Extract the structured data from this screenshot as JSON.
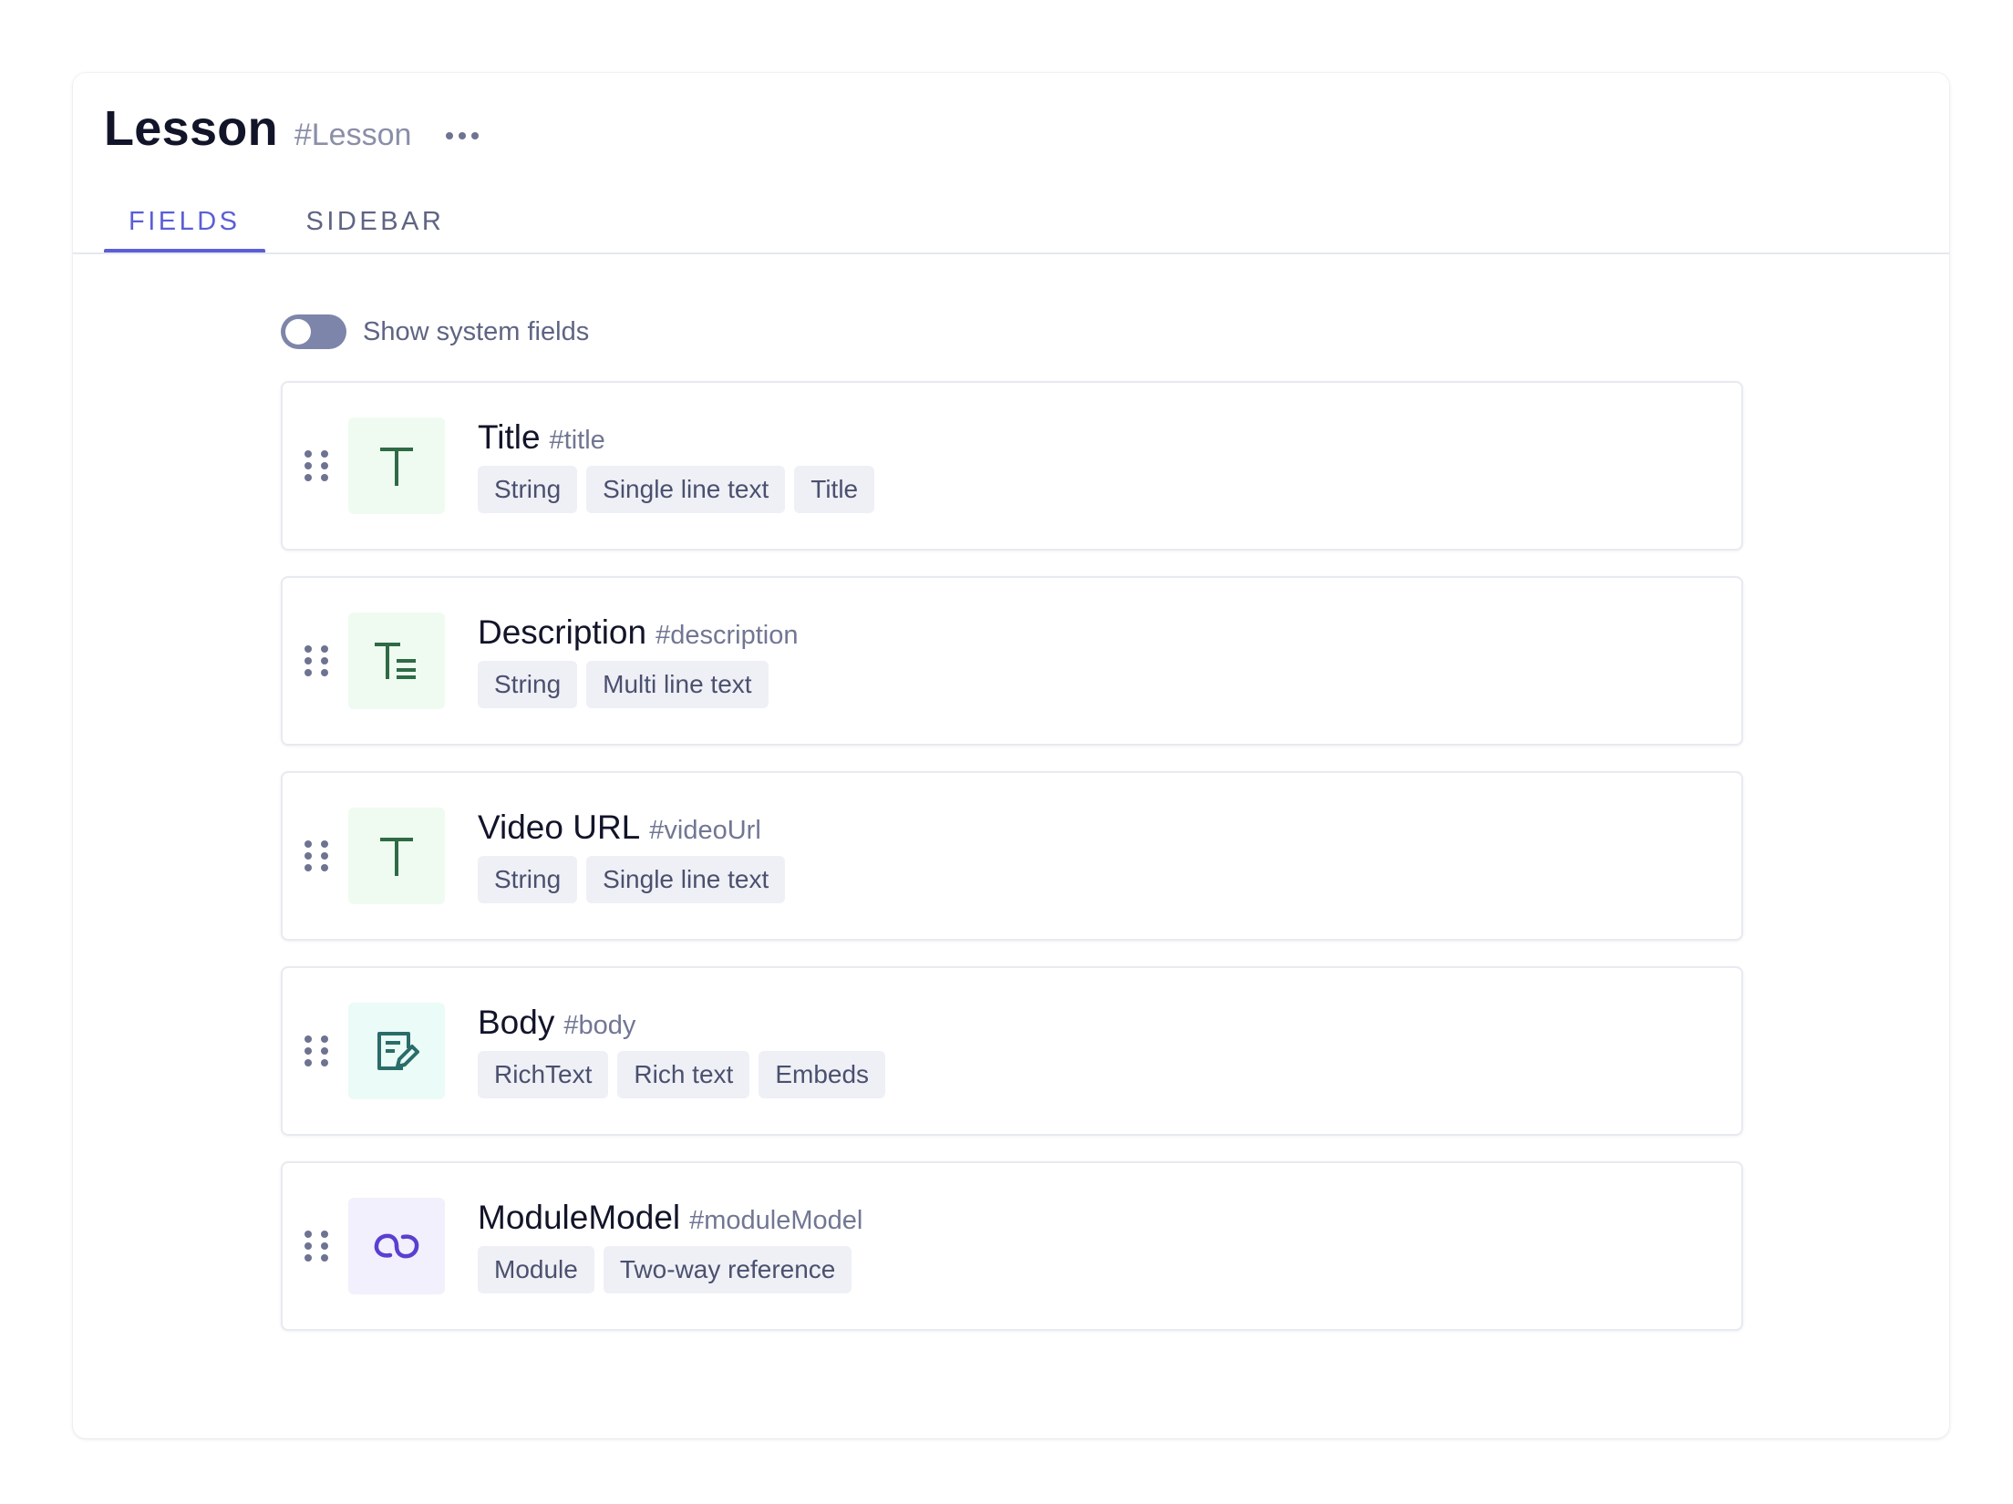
{
  "model": {
    "title": "Lesson",
    "api_id": "#Lesson"
  },
  "tabs": [
    {
      "label": "FIELDS",
      "active": true
    },
    {
      "label": "SIDEBAR",
      "active": false
    }
  ],
  "system_fields_toggle": {
    "label": "Show system fields",
    "on": false
  },
  "fields": [
    {
      "name": "Title",
      "api_id": "#title",
      "icon": "text-icon",
      "tags": [
        "String",
        "Single line text",
        "Title"
      ]
    },
    {
      "name": "Description",
      "api_id": "#description",
      "icon": "multiline-text-icon",
      "tags": [
        "String",
        "Multi line text"
      ]
    },
    {
      "name": "Video URL",
      "api_id": "#videoUrl",
      "icon": "text-icon",
      "tags": [
        "String",
        "Single line text"
      ]
    },
    {
      "name": "Body",
      "api_id": "#body",
      "icon": "rich-text-icon",
      "tags": [
        "RichText",
        "Rich text",
        "Embeds"
      ]
    },
    {
      "name": "ModuleModel",
      "api_id": "#moduleModel",
      "icon": "link-icon",
      "tags": [
        "Module",
        "Two-way reference"
      ]
    }
  ],
  "colors": {
    "accent": "#5b5fd6",
    "text_icon": "#2e6b45",
    "rich_text_icon": "#2a6c6a",
    "reference_icon": "#5b3fd0"
  }
}
